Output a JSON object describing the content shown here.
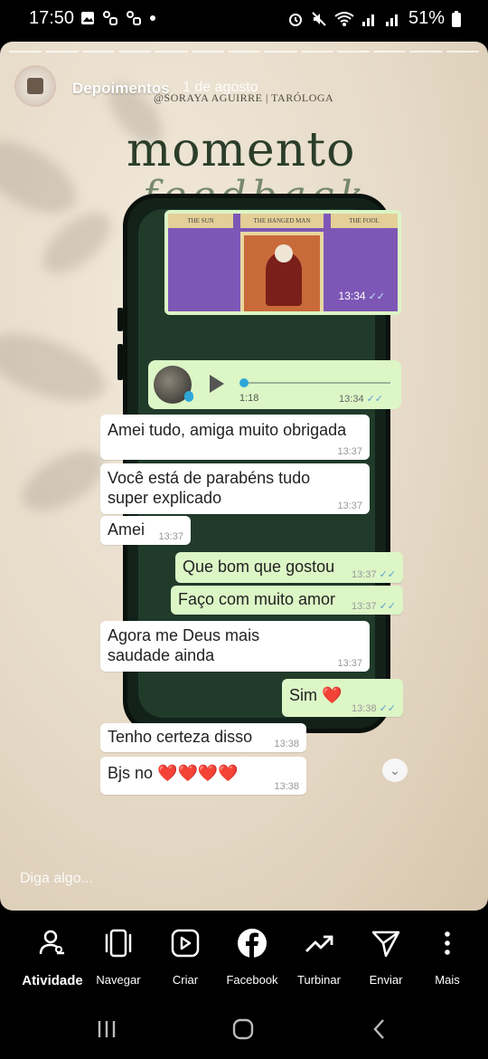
{
  "status": {
    "time": "17:50",
    "battery": "51%"
  },
  "story": {
    "account_name": "Depoimentos",
    "date": "1 de agosto",
    "handle": "@SORAYA AGUIRRE | TARÓLOGA",
    "title_line1": "momento",
    "title_line2": "feedback",
    "reply_placeholder": "Diga algo..."
  },
  "chat": {
    "image_message": {
      "time": "13:34",
      "card_labels": [
        "THE SUN",
        "THE HANGED MAN",
        "THE FOOL"
      ]
    },
    "audio_message": {
      "duration": "1:18",
      "time": "13:34"
    },
    "messages": [
      {
        "dir": "in",
        "text": "Amei tudo, amiga muito obrigada",
        "time": "13:37"
      },
      {
        "dir": "in",
        "text": "Você está de parabéns tudo super explicado",
        "time": "13:37"
      },
      {
        "dir": "in",
        "text": "Amei",
        "time": "13:37"
      },
      {
        "dir": "out",
        "text": "Que bom  que gostou",
        "time": "13:37"
      },
      {
        "dir": "out",
        "text": "Faço com muito amor",
        "time": "13:37"
      },
      {
        "dir": "in",
        "text": "Agora me Deus mais saudade ainda",
        "time": "13:37"
      },
      {
        "dir": "out",
        "text": "Sim ❤️",
        "time": "13:38"
      },
      {
        "dir": "in",
        "text": "Tenho certeza disso",
        "time": "13:38"
      },
      {
        "dir": "in",
        "text": "Bjs no ❤️❤️❤️❤️",
        "time": "13:38"
      }
    ]
  },
  "actions": [
    {
      "label": "Atividade",
      "icon": "activity-icon"
    },
    {
      "label": "Navegar",
      "icon": "browse-icon"
    },
    {
      "label": "Criar",
      "icon": "create-icon"
    },
    {
      "label": "Facebook",
      "icon": "facebook-icon"
    },
    {
      "label": "Turbinar",
      "icon": "boost-icon"
    },
    {
      "label": "Enviar",
      "icon": "send-icon"
    },
    {
      "label": "Mais",
      "icon": "more-icon"
    }
  ],
  "colors": {
    "accent_blue": "#2ea7d8",
    "outgoing_bubble": "#dcf6c6",
    "phone_screen": "#213b2b"
  }
}
